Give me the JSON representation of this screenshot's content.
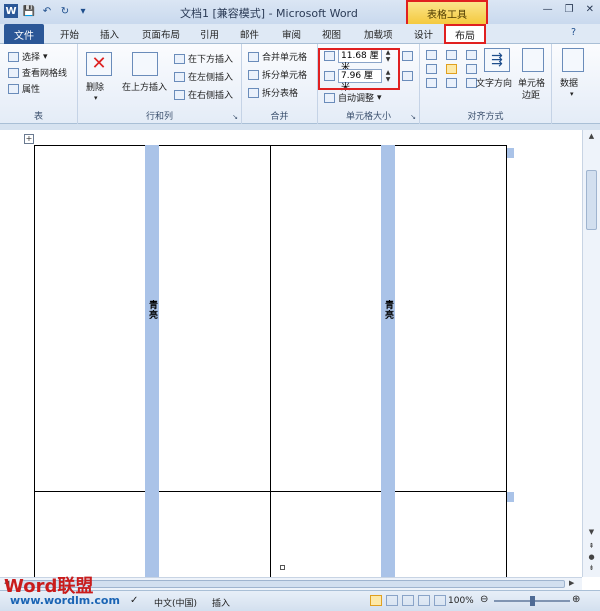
{
  "window": {
    "title": "文档1 [兼容模式] - Microsoft Word",
    "context_tab": "表格工具",
    "minimize": "—",
    "restore": "❐",
    "close": "✕"
  },
  "qat": {
    "word_icon": "W",
    "save": "💾",
    "undo": "↶",
    "redo": "↻",
    "more": "▾"
  },
  "tabs": {
    "file": "文件",
    "home": "开始",
    "insert": "插入",
    "page_layout": "页面布局",
    "references": "引用",
    "mailings": "邮件",
    "review": "审阅",
    "view": "视图",
    "addins": "加载项",
    "design": "设计",
    "layout": "布局"
  },
  "ribbon": {
    "table": {
      "label": "表",
      "select": "选择",
      "gridlines": "查看网格线",
      "properties": "属性"
    },
    "rows_cols": {
      "label": "行和列",
      "delete": "删除",
      "insert_above": "在上方插入",
      "insert_below": "在下方插入",
      "insert_left": "在左侧插入",
      "insert_right": "在右侧插入"
    },
    "merge": {
      "label": "合并",
      "merge_cells": "合并单元格",
      "split_cells": "拆分单元格",
      "split_table": "拆分表格"
    },
    "cell_size": {
      "label": "单元格大小",
      "height": "11.68 厘米",
      "width": "7.96 厘米",
      "autofit": "自动调整"
    },
    "alignment": {
      "label": "对齐方式",
      "text_direction": "文字方向",
      "cell_margins_l1": "单元格",
      "cell_margins_l2": "边距"
    },
    "data": {
      "label": "数据"
    }
  },
  "document": {
    "cell1_text": "青亮",
    "cell2_text": "青亮"
  },
  "status": {
    "language": "中文(中国)",
    "insert_mode": "插入",
    "zoom": "100%"
  },
  "watermark": {
    "brand_latin": "Word",
    "brand_cjk": "联盟",
    "url": "www.wordlm.com"
  },
  "colors": {
    "accent_red": "#e02020",
    "file_tab": "#2b5797",
    "context_yellow": "#f4c93e",
    "highlight": "#aac3e8"
  }
}
